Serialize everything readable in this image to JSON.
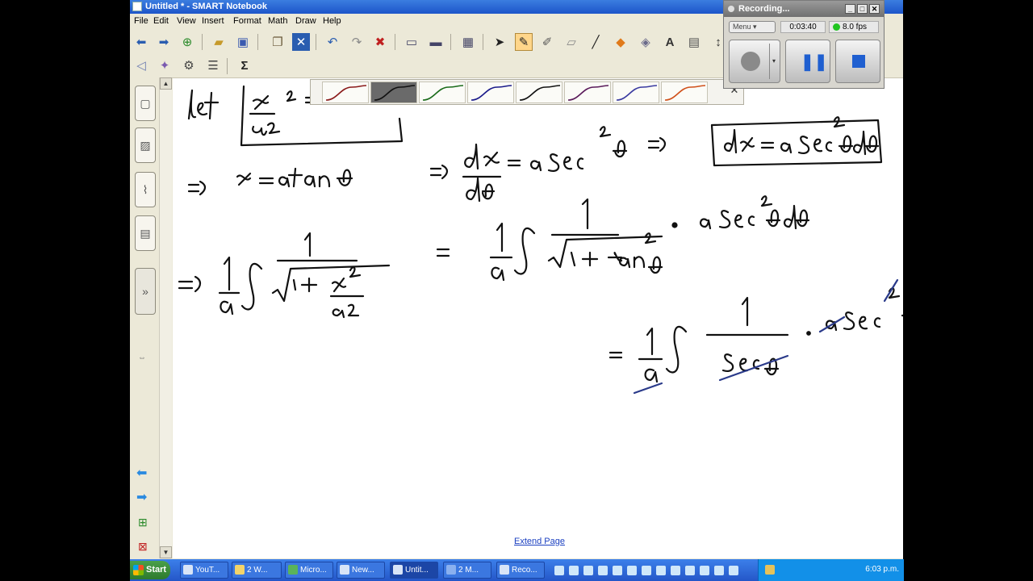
{
  "window": {
    "title": "Untitled * - SMART Notebook"
  },
  "menu": [
    "File",
    "Edit",
    "View",
    "Insert",
    "Format",
    "Math",
    "Draw",
    "Help"
  ],
  "toolbar_icons": {
    "row1": [
      "back-arrow-icon",
      "forward-arrow-icon",
      "add-page-icon",
      "open-folder-icon",
      "save-icon",
      "paste-icon",
      "delete-icon",
      "undo-icon",
      "redo-icon",
      "delete-x-icon",
      "screen-shade-icon",
      "display-icon",
      "table-icon",
      "select-pointer-icon",
      "pen-icon",
      "creative-pen-icon",
      "eraser-icon",
      "line-icon",
      "shapes-icon",
      "fill-icon",
      "text-icon",
      "fonts-icon"
    ],
    "row2": [
      "previous-icon",
      "magic-pen-icon",
      "shape-recognition-icon",
      "properties-icon",
      "sigma-icon"
    ]
  },
  "pen_palette": {
    "colors": [
      "#8a1a1a",
      "#111111",
      "#1a6b1a",
      "#1a1a8a",
      "#111111",
      "#5a1a5a",
      "#3a3aa0",
      "#d0501a"
    ],
    "selected_index": 1
  },
  "recorder": {
    "title": "Recording...",
    "menu_label": "Menu",
    "elapsed": "0:03:40",
    "fps": "8.0 fps"
  },
  "canvas": {
    "extend_link": "Extend Page"
  },
  "taskbar": {
    "start_label": "Start",
    "tasks": [
      "YouT...",
      "2 W...",
      "Micro...",
      "New...",
      "Untit...",
      "2 M...",
      "Reco..."
    ],
    "active_task": 4,
    "clock": "6:03 p.m."
  }
}
